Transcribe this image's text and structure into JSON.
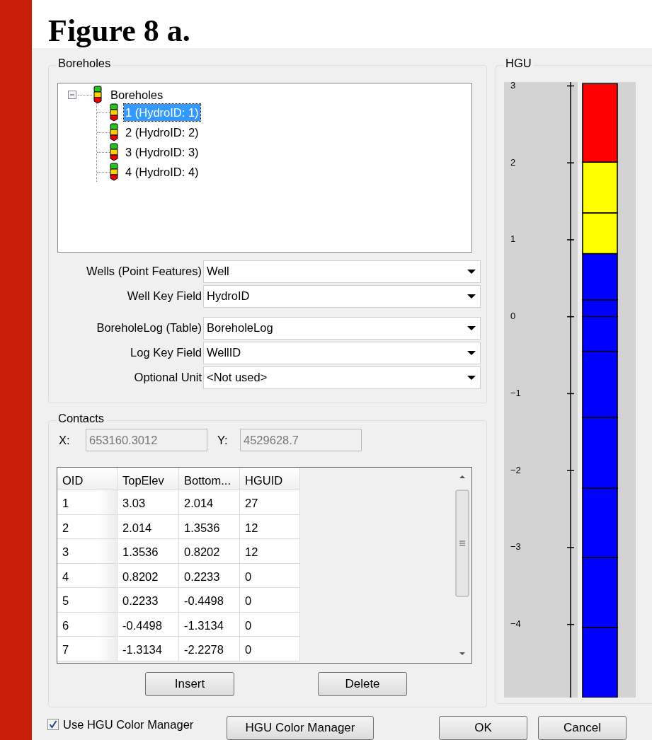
{
  "figure_title": "Figure 8 a.",
  "boreholes": {
    "title": "Boreholes",
    "tree": {
      "label": "Boreholes",
      "expanded": true,
      "children": [
        {
          "label": "1 (HydroID:  1)",
          "selected": true
        },
        {
          "label": "2 (HydroID:  2)",
          "selected": false
        },
        {
          "label": "3 (HydroID:  3)",
          "selected": false
        },
        {
          "label": "4 (HydroID:  4)",
          "selected": false
        }
      ]
    },
    "fields": [
      {
        "label": "Wells (Point Features)",
        "value": "Well"
      },
      {
        "label": "Well Key Field",
        "value": "HydroID"
      },
      {
        "label": "BoreholeLog  (Table)",
        "value": "BoreholeLog"
      },
      {
        "label": "Log Key Field",
        "value": "WellID"
      },
      {
        "label": "Optional Unit",
        "value": "<Not used>"
      }
    ]
  },
  "contacts": {
    "title": "Contacts",
    "coords": [
      {
        "label": "X:",
        "value": "653160.3012",
        "disabled": true
      },
      {
        "label": "Y:",
        "value": "4529628.7",
        "disabled": true
      }
    ],
    "table": {
      "columns": [
        "OID",
        "TopElev",
        "Bottom...",
        "HGUID"
      ],
      "rows": [
        [
          "1",
          "3.03",
          "2.014",
          "27"
        ],
        [
          "2",
          "2.014",
          "1.3536",
          "12"
        ],
        [
          "3",
          "1.3536",
          "0.8202",
          "12"
        ],
        [
          "4",
          "0.8202",
          "0.2233",
          "0"
        ],
        [
          "5",
          "0.2233",
          "-0.4498",
          "0"
        ],
        [
          "6",
          "-0.4498",
          "-1.3134",
          "0"
        ],
        [
          "7",
          "-1.3134",
          "-2.2278",
          "0"
        ]
      ]
    },
    "buttons": [
      "Insert",
      "Delete"
    ]
  },
  "hgu": {
    "title": "HGU",
    "chart_data": {
      "type": "bar",
      "stacked": true,
      "orientation": "vertical",
      "categories": [
        null
      ],
      "ylim": [
        -4.95,
        3.05
      ],
      "yticks": [
        {
          "value": 3,
          "label": "3"
        },
        {
          "value": 2,
          "label": "2"
        },
        {
          "value": 1,
          "label": "1"
        },
        {
          "value": 0,
          "label": "0"
        },
        {
          "value": -1,
          "label": "−1"
        },
        {
          "value": -2,
          "label": "−2"
        },
        {
          "value": -3,
          "label": "−3"
        },
        {
          "value": -4,
          "label": "−4"
        }
      ],
      "series": [
        {
          "color": "#0000ff",
          "values": [
            0.22
          ]
        },
        {
          "color": "#0000ff",
          "values": [
            0.6
          ]
        },
        {
          "color": "#ffff00",
          "values": [
            0.53
          ]
        },
        {
          "color": "#ffff00",
          "values": [
            0.66
          ]
        },
        {
          "color": "#ff0000",
          "values": [
            1.02
          ]
        },
        {
          "color": "#0000ff",
          "values": [
            -0.45
          ]
        },
        {
          "color": "#0000ff",
          "values": [
            -0.86
          ]
        },
        {
          "color": "#0000ff",
          "values": [
            -0.92
          ]
        },
        {
          "color": "#0000ff",
          "values": [
            -0.9
          ]
        },
        {
          "color": "#0000ff",
          "values": [
            -0.91
          ]
        },
        {
          "color": "#0000ff",
          "values": [
            -0.91
          ]
        }
      ]
    }
  },
  "footer": {
    "checkbox": {
      "label": "Use HGU Color Manager",
      "checked": true
    },
    "buttons": [
      "HGU Color Manager",
      "OK",
      "Cancel"
    ]
  }
}
